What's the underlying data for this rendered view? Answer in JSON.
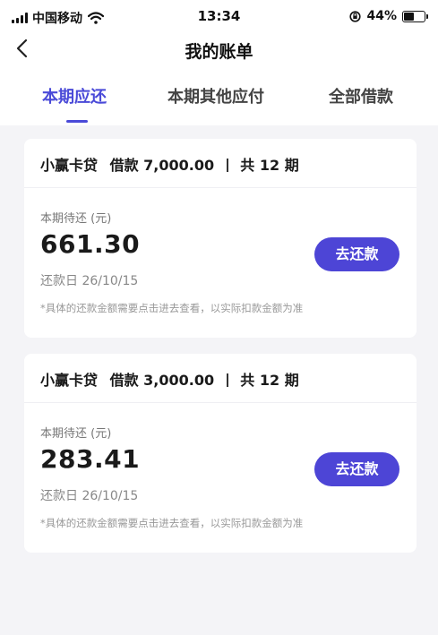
{
  "status_bar": {
    "carrier": "中国移动",
    "time": "13:34",
    "battery": "44%"
  },
  "nav": {
    "title": "我的账单"
  },
  "tabs": [
    {
      "label": "本期应还",
      "active": true
    },
    {
      "label": "本期其他应付",
      "active": false
    },
    {
      "label": "全部借款",
      "active": false
    }
  ],
  "bills": [
    {
      "product": "小赢卡贷",
      "loan_text": "借款 7,000.00",
      "periods_text": "共 12 期",
      "due_label": "本期待还 (元)",
      "amount": "661.30",
      "repay_date": "还款日 26/10/15",
      "note": "*具体的还款金额需要点击进去查看，以实际扣款金额为准",
      "button": "去还款"
    },
    {
      "product": "小赢卡贷",
      "loan_text": "借款 3,000.00",
      "periods_text": "共 12 期",
      "due_label": "本期待还 (元)",
      "amount": "283.41",
      "repay_date": "还款日 26/10/15",
      "note": "*具体的还款金额需要点击进去查看，以实际扣款金额为准",
      "button": "去还款"
    }
  ],
  "colors": {
    "accent": "#4a4ad8",
    "button": "#4d45d6",
    "page_bg": "#f4f4f7"
  }
}
